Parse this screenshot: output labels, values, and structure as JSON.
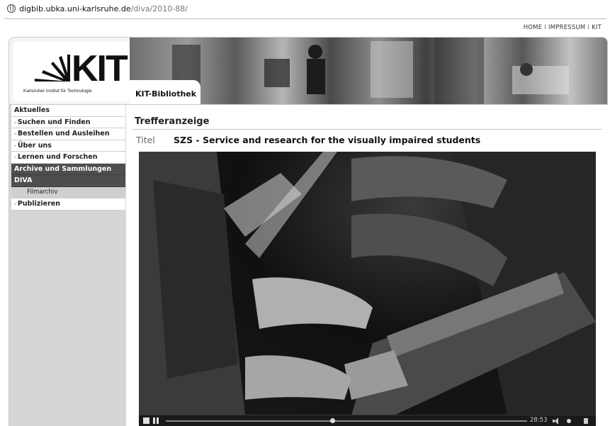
{
  "browser": {
    "url_host": "digbib.ubka.uni-karlsruhe.de",
    "url_path": "/diva/2010-88/"
  },
  "toplinks": {
    "home": "HOME",
    "impressum": "IMPRESSUM",
    "kit": "KIT",
    "separator": "I"
  },
  "header": {
    "logo_text": "KIT",
    "logo_subtitle": "Karlsruher Institut für Technologie",
    "section_tab": "KIT-Bibliothek"
  },
  "nav": {
    "items": [
      {
        "label": "Aktuelles",
        "style": "plain"
      },
      {
        "label": "Suchen und Finden",
        "style": "arrow"
      },
      {
        "label": "Bestellen und Ausleihen",
        "style": "arrow"
      },
      {
        "label": "Über uns",
        "style": "arrow"
      },
      {
        "label": "Lernen und Forschen",
        "style": "arrow"
      },
      {
        "label": "Archive und Sammlungen",
        "style": "dark"
      },
      {
        "label": "DIVA",
        "style": "dark"
      },
      {
        "label": "Filmarchiv",
        "style": "sub"
      },
      {
        "label": "Publizieren",
        "style": "arrow"
      }
    ],
    "arrow_glyph": "›"
  },
  "main": {
    "heading": "Trefferanzeige",
    "title_label": "Titel",
    "title_value": "SZS - Service and research for the visually impaired students"
  },
  "video": {
    "time": "28:53",
    "progress": 0.46
  },
  "colors": {
    "nav_dark": "#4e4e4e",
    "nav_sub": "#cfcfcf",
    "sidebar_bg": "#d6d6d6"
  }
}
